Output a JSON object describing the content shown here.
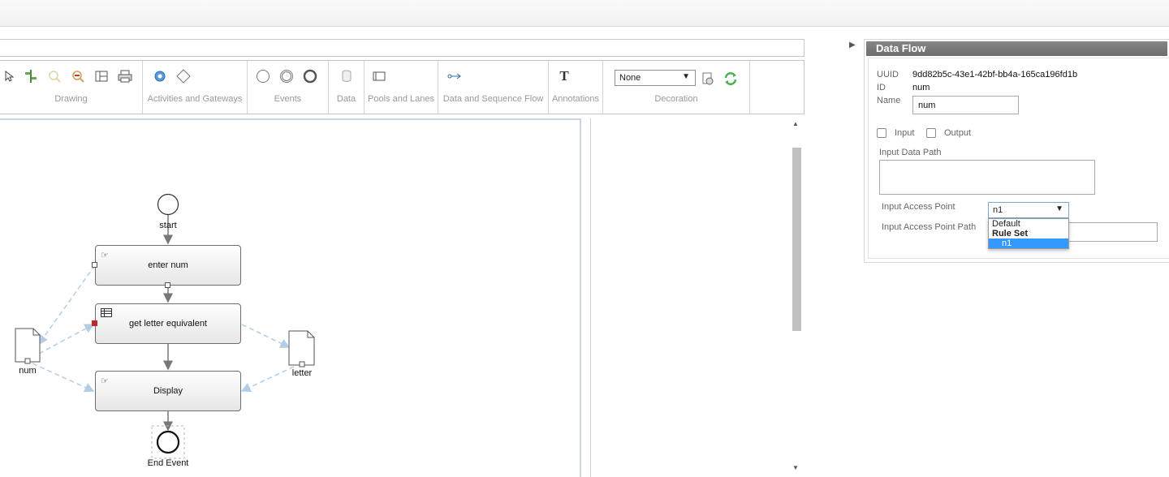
{
  "toolbar": {
    "groups": [
      {
        "label": "Drawing"
      },
      {
        "label": "Activities and Gateways"
      },
      {
        "label": "Events"
      },
      {
        "label": "Data"
      },
      {
        "label": "Pools and Lanes"
      },
      {
        "label": "Data and Sequence Flow"
      },
      {
        "label": "Annotations"
      },
      {
        "label": "Decoration"
      }
    ],
    "decoration_select": "None",
    "annotation_glyph": "T",
    "icons": [
      "pointer-icon",
      "align-icon",
      "zoom-in-icon",
      "zoom-out-icon",
      "layout-icon",
      "print-icon",
      "gear-icon",
      "gateway-diamond-icon",
      "start-event-icon",
      "intermediate-event-icon",
      "end-event-icon",
      "data-store-icon",
      "pool-icon",
      "connector-icon",
      "text-annotation-icon",
      "decoration-settings-icon",
      "refresh-icon"
    ]
  },
  "diagram": {
    "start_label": "start",
    "tasks": [
      {
        "label": "enter num",
        "icon": "hand-icon"
      },
      {
        "label": "get letter equivalent",
        "icon": "table-icon"
      },
      {
        "label": "Display",
        "icon": "hand-icon"
      }
    ],
    "data_objects": [
      {
        "label": "num"
      },
      {
        "label": "letter"
      }
    ],
    "end_label": "End Event"
  },
  "panel": {
    "title": "Data Flow",
    "uuid_label": "UUID",
    "uuid_value": "9dd82b5c-43e1-42bf-bb4a-165ca196fd1b",
    "id_label": "ID",
    "id_value": "num",
    "name_label": "Name",
    "name_value": "num",
    "input_label": "Input",
    "output_label": "Output",
    "input_data_path_label": "Input Data Path",
    "input_access_point_label": "Input Access Point",
    "input_access_point_value": "n1",
    "input_access_point_path_label": "Input Access Point Path",
    "dropdown_options": [
      "Default",
      "Rule Set",
      "n1"
    ]
  },
  "colors": {
    "accent": "#3399ff",
    "panel_header": "#7a7a7a",
    "flow_line": "#b3cde6"
  }
}
